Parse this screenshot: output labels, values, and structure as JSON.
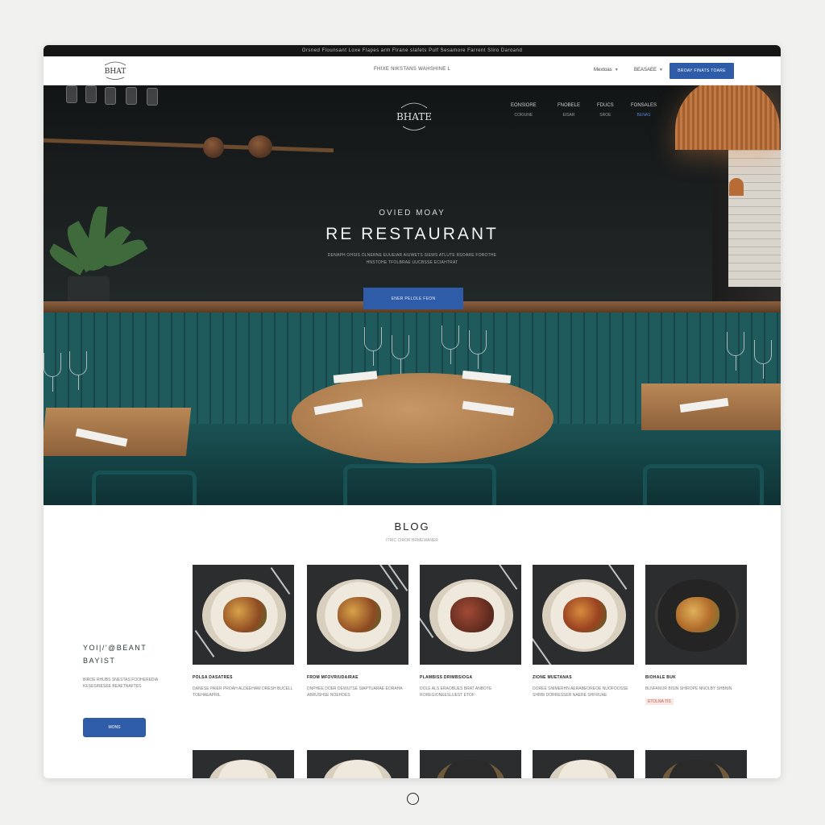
{
  "announcement": "Orsned Flounsant Loxe Flapes arm Flrane slafets Pulf Sesamore Farrent Sliro Daroand",
  "topnav": {
    "logo_text": "BHAT",
    "center_link": "FHIXE NIKSTANS WAHSHINE L",
    "menu_label": "Mextoas",
    "account_label": "BEASAEE",
    "book_button": "BROAY FINATS TOARE"
  },
  "hero": {
    "logo_text": "BHATE",
    "nav": [
      {
        "label": "EONSIORE",
        "sub": "COKIUNE",
        "active": false
      },
      {
        "label": "FNOBELE",
        "sub": "EISAR",
        "active": false
      },
      {
        "label": "FDUCS",
        "sub": "SROE",
        "active": false
      },
      {
        "label": "FONSALES",
        "sub": "BENAS",
        "active": true
      }
    ],
    "eyebrow": "OVIED MOAY",
    "title": "RE RESTAURANT",
    "description": "DENAPH OHSIS OLNERNE EUUEIAR AIUWETS SIEWS ATLUTE RSOARE FOROTHE HNSTOHE TFOLBRAE UUCBSSE ECIAHTRAT",
    "cta": "ENER PELOLE FEON"
  },
  "blog": {
    "title": "BLOG",
    "subtitle": "ITRIC CIROR BRMEWANER"
  },
  "sidebar": {
    "heading_line1": "YOI|/'@BEANT",
    "heading_line2": "BAYIST",
    "description": "BIROE RHUBS SNESTAS FOOHEREDIA KESESIRESEE BEAETNAFTES",
    "button": "MONS"
  },
  "cards": [
    {
      "name": "POLSA DASATRES",
      "desc": "DANESE PAIER PROAH ALDEEHAW DRESH BUCELL TOEHAEAPRIL",
      "tag": ""
    },
    {
      "name": "FROM MFOVRIUDAIRAE",
      "desc": "DNPHEE DOER DEWUTSE SIAPTUARAE EORAHA ABRUSHSE NOEHDES",
      "tag": ""
    },
    {
      "name": "PLAMBISS DRIMBSIOGA",
      "desc": "DOLE ALS ERAOBUES BRAT ANBOTE ROREGIONEESLUEST ETOF",
      "tag": ""
    },
    {
      "name": "ZIONE MUETANAS",
      "desc": "DOREE SNIMERHN AERABEOREOE NUOFOOSSE SHRBI DORRESSER NAERE SHFRUAE",
      "tag": ""
    },
    {
      "name": "BIOHALE BUK",
      "desc": "BLNFANOR BISIN SHIROPE NNOLBY SHBNIN",
      "tag": "ETOLNA TIS"
    }
  ],
  "colors": {
    "accent": "#2f5ca8",
    "booth_teal": "#1f5a5c",
    "wood": "#b98856"
  }
}
